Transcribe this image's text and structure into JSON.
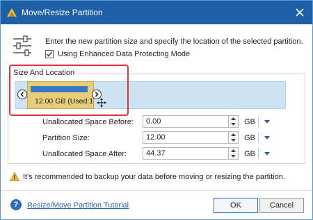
{
  "window": {
    "title": "Move/Resize Partition",
    "title_bar_color": "#1f5fa8"
  },
  "intro": {
    "text": "Enter the new partition size and specify the location of the selected partition.",
    "checkbox_label": "Using Enhanced Data Protecting Mode",
    "checkbox_checked": true
  },
  "size_location": {
    "group_title": "Size And Location",
    "partition_label": "12.00 GB (Used:19",
    "highlight_color": "#d9363e"
  },
  "fields": {
    "unalloc_before": {
      "label": "Unallocated Space Before:",
      "value": "0.00",
      "unit": "GB"
    },
    "partition_size": {
      "label": "Partition Size:",
      "value": "12.00",
      "unit": "GB"
    },
    "unalloc_after": {
      "label": "Unallocated Space After:",
      "value": "44.37",
      "unit": "GB"
    }
  },
  "warning": {
    "text": "It's recommended to backup your data before moving or resizing the partition."
  },
  "footer": {
    "help_link": "Resize/Move Partition Tutorial",
    "ok_label": "OK",
    "cancel_label": "Cancel"
  },
  "icons": {
    "app": "app-icon",
    "close": "close-icon",
    "sliders": "sliders-icon",
    "warning": "warning-icon",
    "help": "help-icon",
    "move_cursor": "move-cursor-icon"
  }
}
